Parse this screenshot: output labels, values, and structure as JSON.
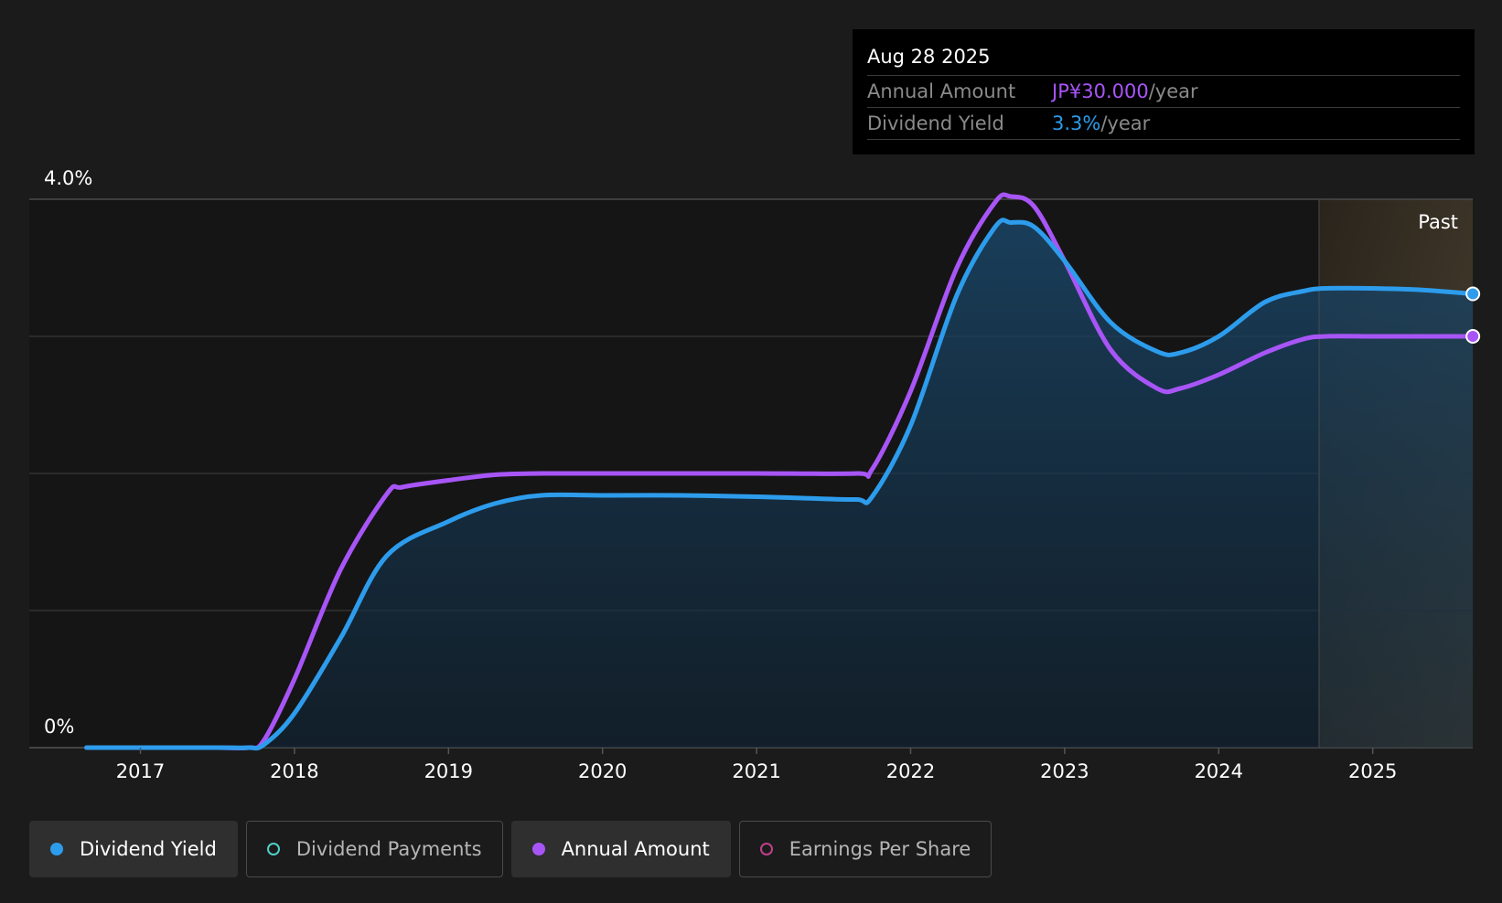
{
  "tooltip": {
    "date": "Aug 28 2025",
    "rows": [
      {
        "label": "Annual Amount",
        "value": "JP¥30.000",
        "suffix": "/year",
        "color": "#a855f7"
      },
      {
        "label": "Dividend Yield",
        "value": "3.3%",
        "suffix": "/year",
        "color": "#2d9cec"
      }
    ]
  },
  "past_label": "Past",
  "legend": [
    {
      "label": "Dividend Yield",
      "color": "#2d9cec",
      "filled": true,
      "active": true
    },
    {
      "label": "Dividend Payments",
      "color": "#4fd1c5",
      "filled": false,
      "active": false
    },
    {
      "label": "Annual Amount",
      "color": "#a855f7",
      "filled": true,
      "active": true
    },
    {
      "label": "Earnings Per Share",
      "color": "#c0408a",
      "filled": false,
      "active": false
    }
  ],
  "chart_data": {
    "type": "area",
    "ylim": [
      0,
      4.0
    ],
    "y_tick_labels": [
      "4.0%",
      "0%"
    ],
    "x_ticks": [
      2017,
      2018,
      2019,
      2020,
      2021,
      2022,
      2023,
      2024,
      2025
    ],
    "x_range": [
      2016.65,
      2025.65
    ],
    "past_region_start": 2024.65,
    "grid": true,
    "series": [
      {
        "name": "Dividend Yield",
        "color": "#2d9cec",
        "filled": true,
        "x": [
          2016.65,
          2017.0,
          2017.5,
          2017.7,
          2017.8,
          2018.0,
          2018.3,
          2018.6,
          2019.0,
          2019.3,
          2019.6,
          2020.0,
          2020.5,
          2021.0,
          2021.3,
          2021.65,
          2021.75,
          2022.0,
          2022.3,
          2022.55,
          2022.65,
          2022.8,
          2023.0,
          2023.3,
          2023.6,
          2023.75,
          2024.0,
          2024.3,
          2024.55,
          2024.7,
          2025.0,
          2025.3,
          2025.65
        ],
        "values": [
          0.0,
          0.0,
          0.0,
          0.0,
          0.02,
          0.25,
          0.8,
          1.4,
          1.65,
          1.78,
          1.84,
          1.84,
          1.84,
          1.83,
          1.82,
          1.81,
          1.83,
          2.35,
          3.3,
          3.8,
          3.83,
          3.8,
          3.55,
          3.1,
          2.89,
          2.88,
          3.0,
          3.25,
          3.33,
          3.35,
          3.35,
          3.34,
          3.31
        ]
      },
      {
        "name": "Annual Amount",
        "color": "#a855f7",
        "filled": false,
        "x": [
          2016.65,
          2017.0,
          2017.5,
          2017.7,
          2017.8,
          2018.0,
          2018.3,
          2018.6,
          2018.7,
          2019.0,
          2019.3,
          2019.6,
          2020.0,
          2020.5,
          2021.0,
          2021.65,
          2021.75,
          2022.0,
          2022.3,
          2022.55,
          2022.65,
          2022.8,
          2023.0,
          2023.3,
          2023.6,
          2023.75,
          2024.0,
          2024.3,
          2024.55,
          2024.7,
          2025.0,
          2025.3,
          2025.65
        ],
        "values": [
          0.0,
          0.0,
          0.0,
          0.0,
          0.05,
          0.5,
          1.3,
          1.85,
          1.9,
          1.95,
          1.99,
          2.0,
          2.0,
          2.0,
          2.0,
          2.0,
          2.03,
          2.6,
          3.5,
          3.98,
          4.02,
          3.95,
          3.55,
          2.9,
          2.62,
          2.62,
          2.72,
          2.88,
          2.98,
          3.0,
          3.0,
          3.0,
          3.0
        ]
      }
    ]
  }
}
